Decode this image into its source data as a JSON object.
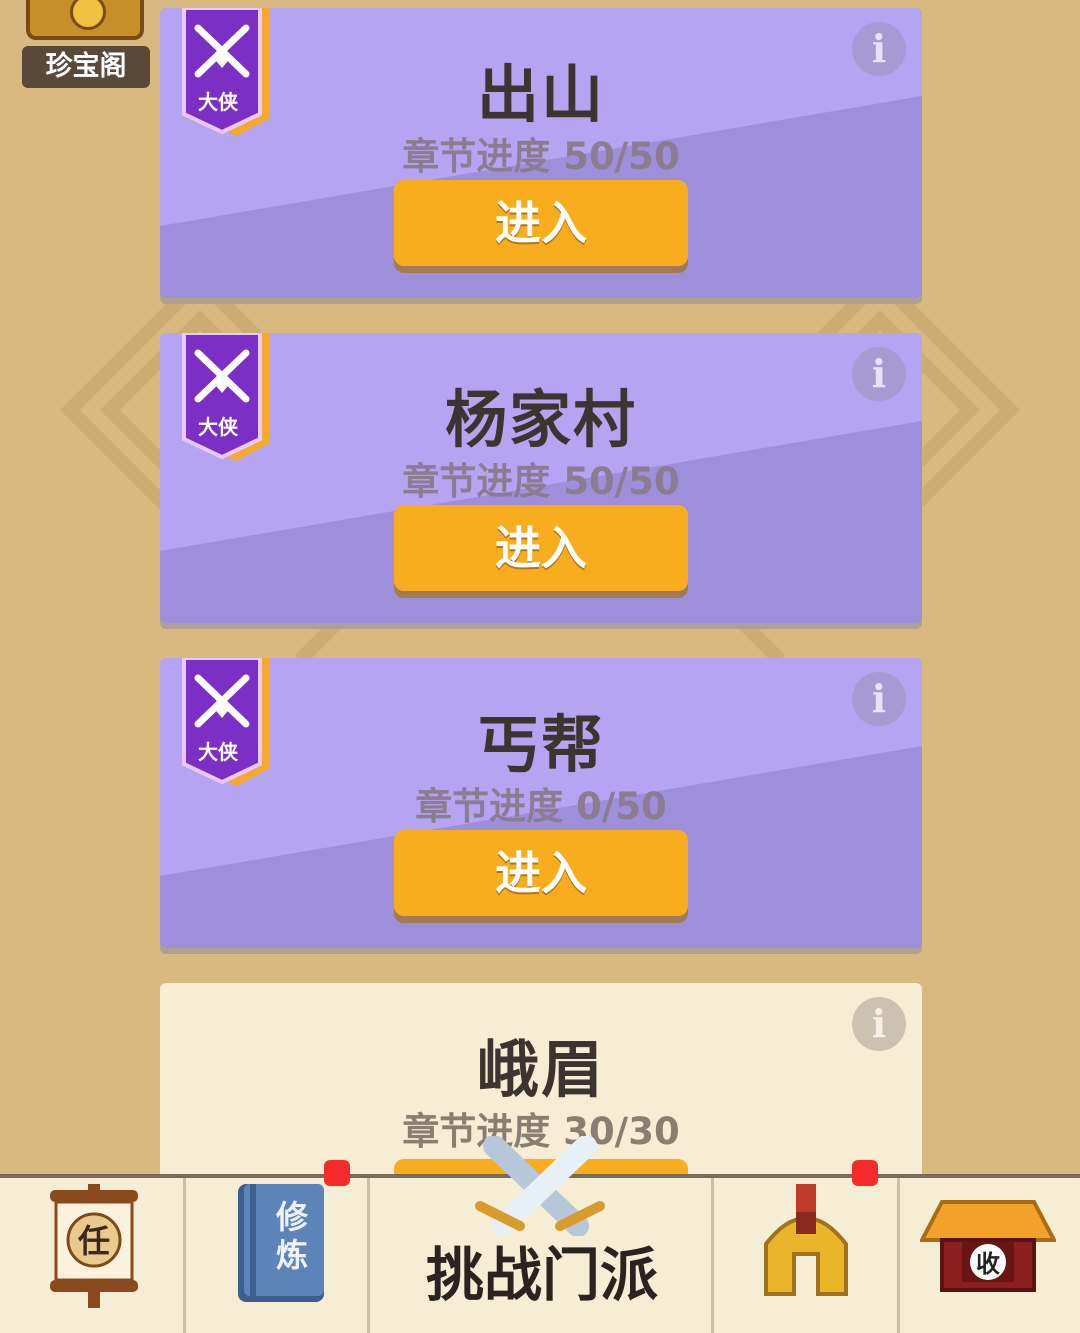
{
  "treasure": {
    "label": "珍宝阁"
  },
  "cards": [
    {
      "title": "出山",
      "progress": "章节进度 50/50",
      "badge": "大侠",
      "button": "进入"
    },
    {
      "title": "杨家村",
      "progress": "章节进度 50/50",
      "badge": "大侠",
      "button": "进入"
    },
    {
      "title": "丐帮",
      "progress": "章节进度 0/50",
      "badge": "大侠",
      "button": "进入"
    },
    {
      "title": "峨眉",
      "progress": "章节进度 30/30"
    }
  ],
  "info_glyph": "i",
  "bottom_nav": {
    "task_char": "任",
    "train_chars": "修炼",
    "challenge_label": "挑战门派",
    "collect_char": "收"
  },
  "colors": {
    "card_purple": "#9d8fd9",
    "card_cream": "#f7ecd4",
    "button_orange": "#f7ad1e",
    "notification_red": "#f52a2a",
    "background": "#d8b97f"
  },
  "icons": [
    "treasure-chest-icon",
    "crossed-swords-icon",
    "info-icon",
    "scroll-icon",
    "book-icon",
    "helmet-icon",
    "shop-icon"
  ]
}
